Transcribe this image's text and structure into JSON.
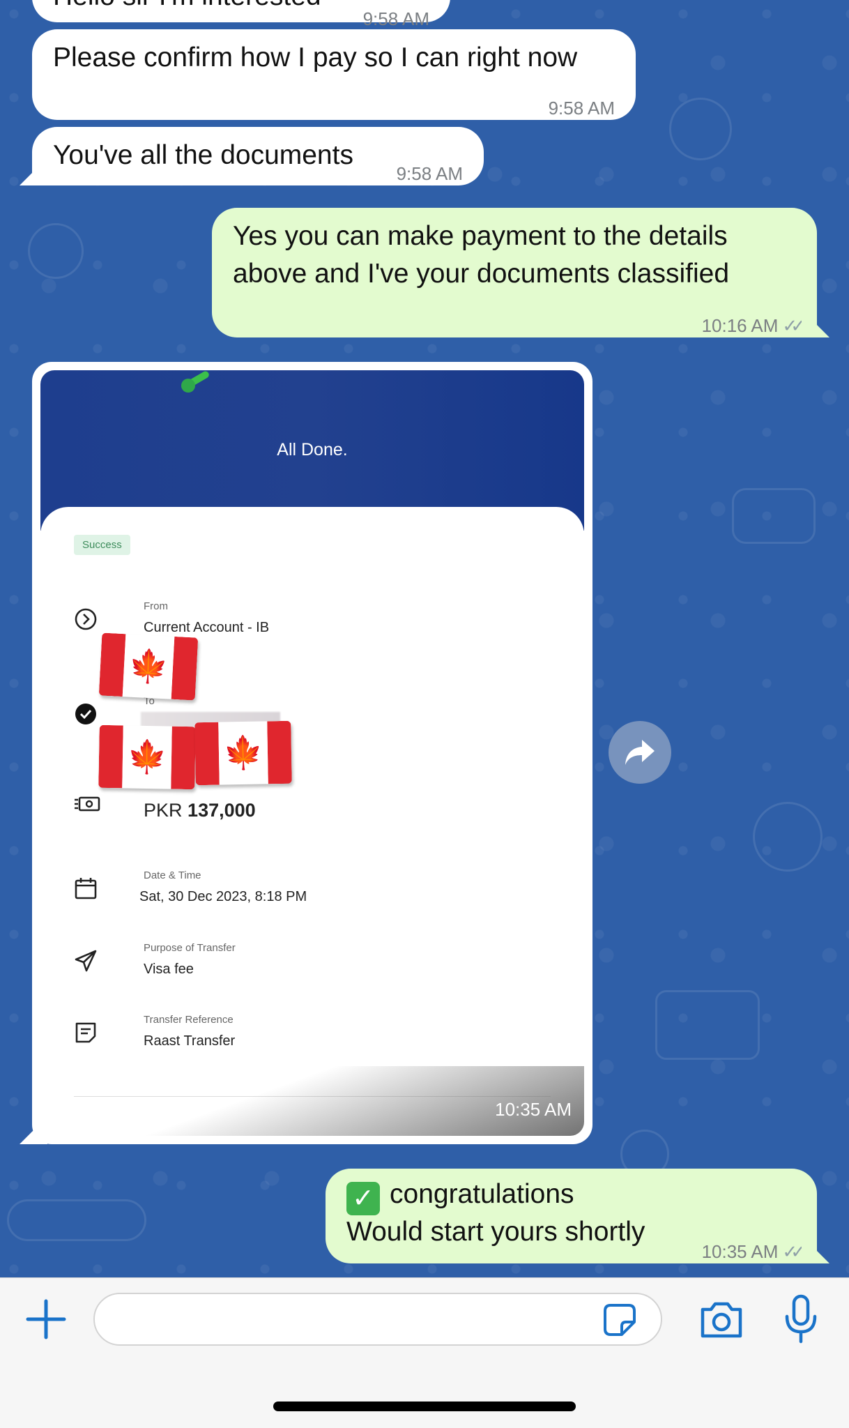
{
  "messages": [
    {
      "id": "m0",
      "direction": "incoming",
      "text": "Hello sir I'm interested",
      "time": "9:58 AM"
    },
    {
      "id": "m1",
      "direction": "incoming",
      "text": "Please confirm how I pay so I can right now",
      "time": "9:58 AM"
    },
    {
      "id": "m2",
      "direction": "incoming",
      "text": "You've all the documents",
      "time": "9:58 AM"
    },
    {
      "id": "m3",
      "direction": "outgoing",
      "text_line1": "Yes you can make payment to the details",
      "text_line2": "above and I've your documents classified",
      "time": "10:16 AM"
    },
    {
      "id": "m5",
      "direction": "outgoing",
      "emoji": "✅",
      "text_line1": "congratulations",
      "text_line2": "Would start yours shortly",
      "time": "10:35 AM"
    }
  ],
  "receipt": {
    "time": "10:35 AM",
    "header_title": "All Done.",
    "status_badge": "Success",
    "from_label": "From",
    "from_value": "Current Account - IB",
    "to_label": "To",
    "amount_currency": "PKR",
    "amount_value": "137,000",
    "date_label": "Date & Time",
    "date_value": "Sat, 30 Dec 2023, 8:18 PM",
    "purpose_label": "Purpose of Transfer",
    "purpose_value": "Visa fee",
    "reference_label": "Transfer Reference",
    "reference_value": "Raast Transfer"
  },
  "colors": {
    "chat_background": "#2f5fa8",
    "incoming_bubble": "#ffffff",
    "outgoing_bubble": "#e3fbcf",
    "receipt_header": "#1e3e8e",
    "accent_blue": "#1a73c9"
  },
  "icons": {
    "forward": "forward-arrow-icon",
    "plus": "plus-icon",
    "sticker": "sticker-icon",
    "camera": "camera-icon",
    "mic": "microphone-icon"
  }
}
